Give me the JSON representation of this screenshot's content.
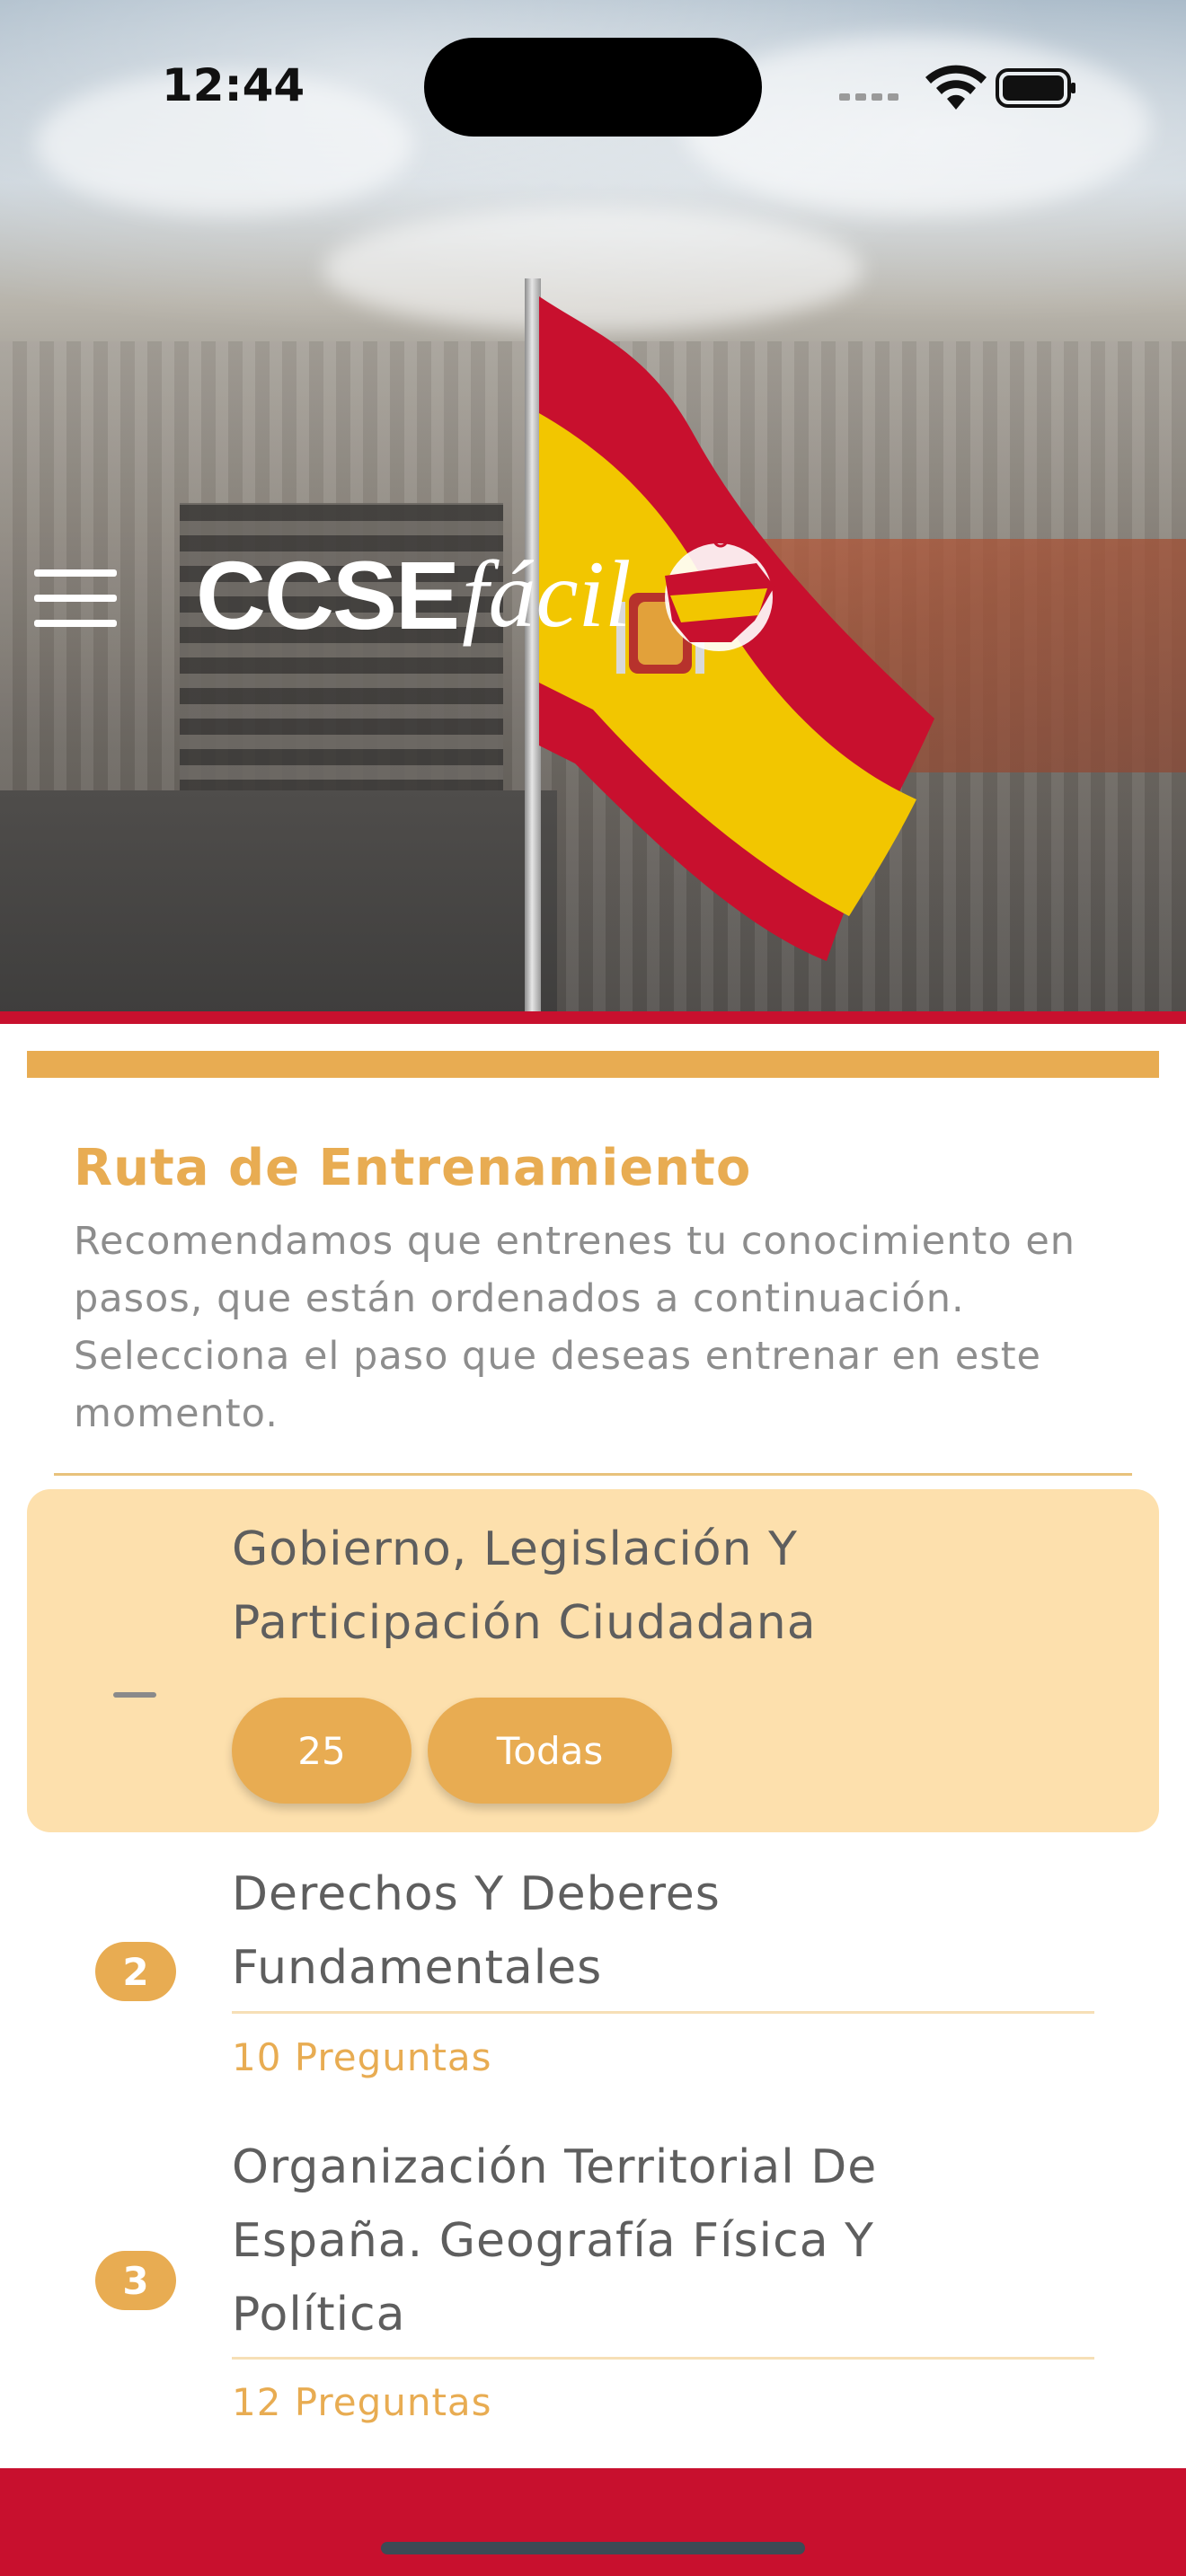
{
  "status_bar": {
    "time": "12:44"
  },
  "header": {
    "logo_bold": "CCSE",
    "logo_script": "fácil",
    "icons": {
      "menu": "hamburger-menu-icon",
      "logo_mark": "spain-map-icon"
    }
  },
  "colors": {
    "accent": "#e8ac52",
    "brand_red": "#c8102e",
    "active_card": "#fde0ad"
  },
  "training": {
    "title": "Ruta de Entrenamiento",
    "description": "Recomendamos que entrenes tu conocimiento en pasos, que están ordenados a continuación. Selecciona el paso que deseas entrenar en este momento."
  },
  "steps": [
    {
      "title_line1": "Gobierno, Legislación Y",
      "title_line2": "Participación Ciudadana",
      "option_1": "25",
      "option_2": "Todas"
    },
    {
      "number": "2",
      "title_line1": "Derechos Y Deberes",
      "title_line2": "Fundamentales",
      "count": "10 Preguntas"
    },
    {
      "number": "3",
      "title_line1": "Organización Territorial De",
      "title_line2": "España. Geografía Física Y",
      "title_line3": "Política",
      "count": "12 Preguntas"
    }
  ]
}
